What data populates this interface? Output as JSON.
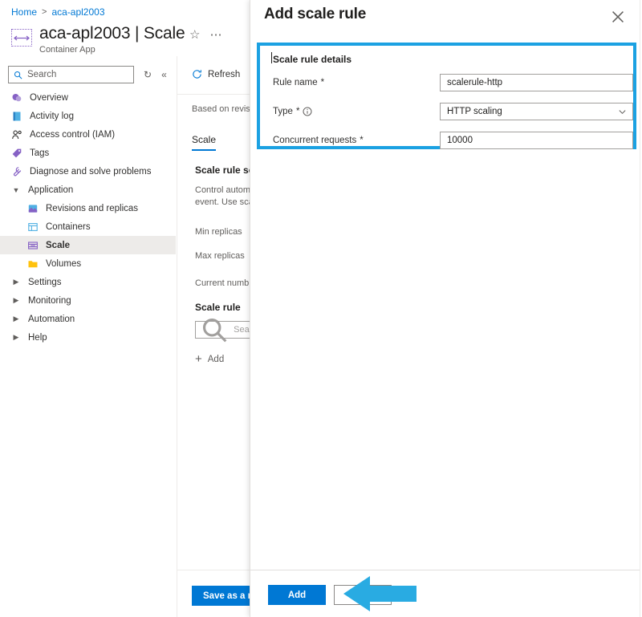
{
  "breadcrumb": {
    "home": "Home",
    "separator": ">",
    "current": "aca-apl2003"
  },
  "resource": {
    "name": "aca-apl2003 | Scale",
    "type": "Container App",
    "icon": "container-app-icon",
    "favorite_icon": "star-icon",
    "more_icon": "ellipsis-icon"
  },
  "nav": {
    "search_placeholder": "Search",
    "search_icon": "search-icon",
    "refresh_icon": "refresh-icon",
    "collapse_icon": "double-chevron-left-icon",
    "items": [
      {
        "label": "Overview",
        "icon": "overview-icon",
        "level": 0,
        "type": "item",
        "selected": false
      },
      {
        "label": "Activity log",
        "icon": "activity-log-icon",
        "level": 0,
        "type": "item",
        "selected": false
      },
      {
        "label": "Access control (IAM)",
        "icon": "access-control-icon",
        "level": 0,
        "type": "item",
        "selected": false
      },
      {
        "label": "Tags",
        "icon": "tags-icon",
        "level": 0,
        "type": "item",
        "selected": false
      },
      {
        "label": "Diagnose and solve problems",
        "icon": "diagnose-icon",
        "level": 0,
        "type": "item",
        "selected": false
      },
      {
        "label": "Application",
        "icon": "chevron-down-icon",
        "level": 0,
        "type": "group-expanded",
        "selected": false
      },
      {
        "label": "Revisions and replicas",
        "icon": "revisions-icon",
        "level": 1,
        "type": "item",
        "selected": false
      },
      {
        "label": "Containers",
        "icon": "containers-icon",
        "level": 1,
        "type": "item",
        "selected": false
      },
      {
        "label": "Scale",
        "icon": "scale-icon",
        "level": 1,
        "type": "item",
        "selected": true
      },
      {
        "label": "Volumes",
        "icon": "volumes-icon",
        "level": 1,
        "type": "item",
        "selected": false
      },
      {
        "label": "Settings",
        "icon": "chevron-right-icon",
        "level": 0,
        "type": "group-collapsed",
        "selected": false
      },
      {
        "label": "Monitoring",
        "icon": "chevron-right-icon",
        "level": 0,
        "type": "group-collapsed",
        "selected": false
      },
      {
        "label": "Automation",
        "icon": "chevron-right-icon",
        "level": 0,
        "type": "group-collapsed",
        "selected": false
      },
      {
        "label": "Help",
        "icon": "chevron-right-icon",
        "level": 0,
        "type": "group-collapsed",
        "selected": false
      }
    ]
  },
  "main": {
    "refresh_label": "Refresh",
    "based_on": "Based on revisi",
    "tab_label": "Scale",
    "section_heading": "Scale rule set",
    "description_line1": "Control autom",
    "description_line2": "event. Use sca",
    "min_replicas_label": "Min replicas",
    "max_replicas_label": "Max replicas",
    "current_number_label": "Current numb",
    "scale_rule_heading": "Scale rule",
    "rule_search_placeholder": "Search",
    "add_label": "Add",
    "save_revision_label": "Save as a new revision"
  },
  "blade": {
    "title": "Add scale rule",
    "close_icon": "close-icon",
    "section": {
      "heading": "Scale rule details",
      "highlight_color": "#1ba1e2",
      "fields": [
        {
          "label": "Rule name",
          "required": "*",
          "value": "scalerule-http",
          "kind": "text",
          "info": false
        },
        {
          "label": "Type",
          "required": "*",
          "value": "HTTP scaling",
          "kind": "select",
          "info": true
        },
        {
          "label": "Concurrent requests",
          "required": "*",
          "value": "10000",
          "kind": "text",
          "info": false
        }
      ]
    },
    "footer": {
      "primary_label": "Add",
      "secondary_label": "",
      "primary_color": "#0078d4"
    },
    "annotation": {
      "shape": "left-arrow",
      "color": "#29abe2"
    }
  }
}
